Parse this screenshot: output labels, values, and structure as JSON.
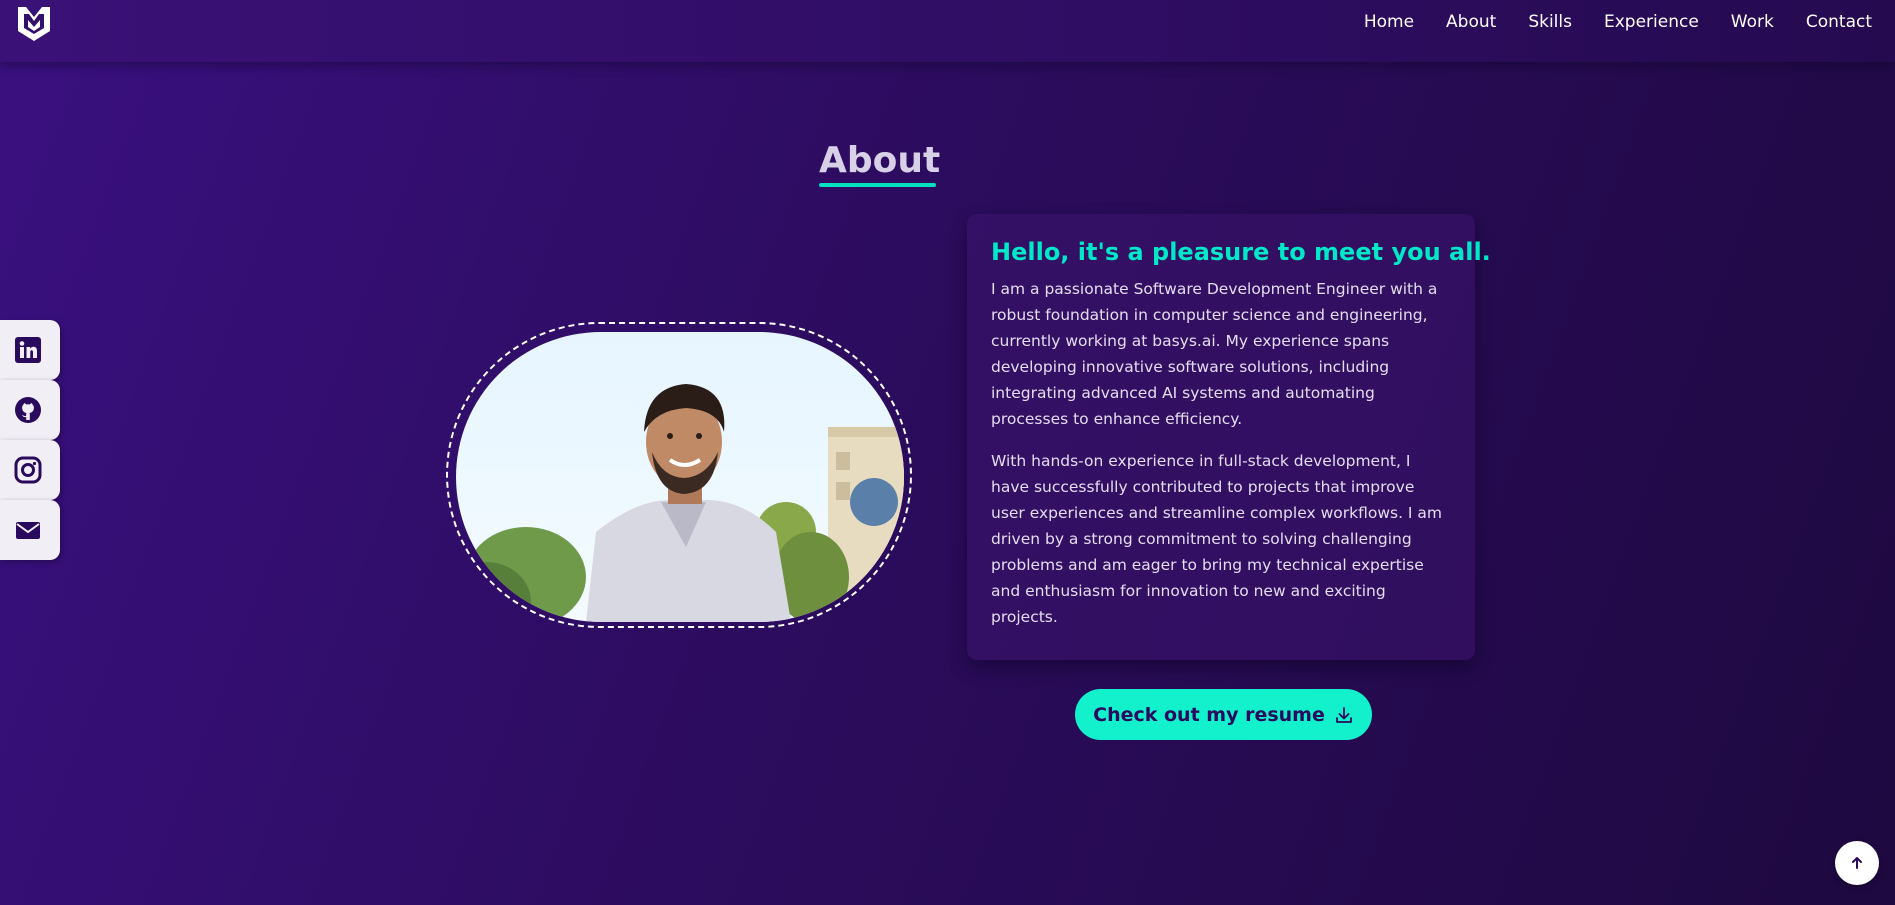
{
  "navbar": {
    "logo_icon": "monogram-shield-logo",
    "links": [
      "Home",
      "About",
      "Skills",
      "Experience",
      "Work",
      "Contact"
    ]
  },
  "about": {
    "title": "About",
    "heading": "Hello, it's a pleasure to meet you all.",
    "paragraphs": [
      "I am a passionate Software Development Engineer with a robust foundation in computer science and engineering, currently working at basys.ai. My experience spans developing innovative software solutions, including integrating advanced AI systems and automating processes to enhance efficiency.",
      "With hands-on experience in full-stack development, I have successfully contributed to projects that improve user experiences and streamline complex workflows. I am driven by a strong commitment to solving challenging problems and am eager to bring my technical expertise and enthusiasm for innovation to new and exciting projects."
    ],
    "resume_button": "Check out my resume",
    "resume_icon": "download-icon",
    "photo_alt": "portrait-photo"
  },
  "social": [
    {
      "icon": "linkedin-icon"
    },
    {
      "icon": "github-icon"
    },
    {
      "icon": "instagram-icon"
    },
    {
      "icon": "mail-icon"
    }
  ],
  "scroll_top_icon": "arrow-up-icon",
  "colors": {
    "accent": "#00e8c8",
    "button": "#12f0cc",
    "background": "#2c0c5e",
    "icon_dark": "#2a0a5c"
  }
}
